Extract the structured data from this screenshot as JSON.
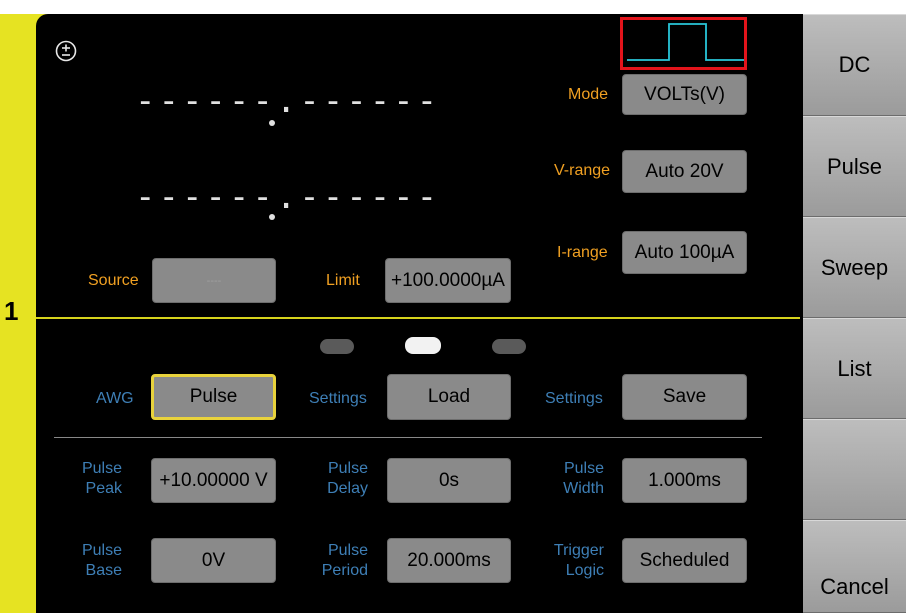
{
  "channel": {
    "number": "1"
  },
  "display": {
    "reading_top": "------.------",
    "reading_bottom": "------.------"
  },
  "source": {
    "label": "Source",
    "value": "----"
  },
  "limit": {
    "label": "Limit",
    "value": "+100.0000µA"
  },
  "mode": {
    "label": "Mode",
    "value": "VOLTs(V)"
  },
  "v_range": {
    "label": "V-range",
    "value": "Auto 20V"
  },
  "i_range": {
    "label": "I-range",
    "value": "Auto 100µA"
  },
  "awg": {
    "label": "AWG",
    "value": "Pulse"
  },
  "settings_load": {
    "label": "Settings",
    "value": "Load"
  },
  "settings_save": {
    "label": "Settings",
    "value": "Save"
  },
  "pulse_peak": {
    "label_1": "Pulse",
    "label_2": "Peak",
    "value": "+10.00000 V"
  },
  "pulse_delay": {
    "label_1": "Pulse",
    "label_2": "Delay",
    "value": "0s"
  },
  "pulse_width": {
    "label_1": "Pulse",
    "label_2": "Width",
    "value": "1.000ms"
  },
  "pulse_base": {
    "label_1": "Pulse",
    "label_2": "Base",
    "value": "0V"
  },
  "pulse_period": {
    "label_1": "Pulse",
    "label_2": "Period",
    "value": "20.000ms"
  },
  "trigger_logic": {
    "label_1": "Trigger",
    "label_2": "Logic",
    "value": "Scheduled"
  },
  "pager": {
    "active_index": 1,
    "count": 3
  },
  "sidebar": {
    "items": [
      "DC",
      "Pulse",
      "Sweep",
      "List",
      "",
      "Cancel"
    ]
  },
  "colors": {
    "accent_yellow": "#e6e322",
    "label_orange": "#f0a022",
    "label_blue": "#3e7fb6",
    "highlight_red": "#e2141b",
    "waveform_cyan": "#29c6d9"
  },
  "icons": {
    "polarity": "plus-minus-icon",
    "waveform": "pulse-waveform-icon"
  }
}
